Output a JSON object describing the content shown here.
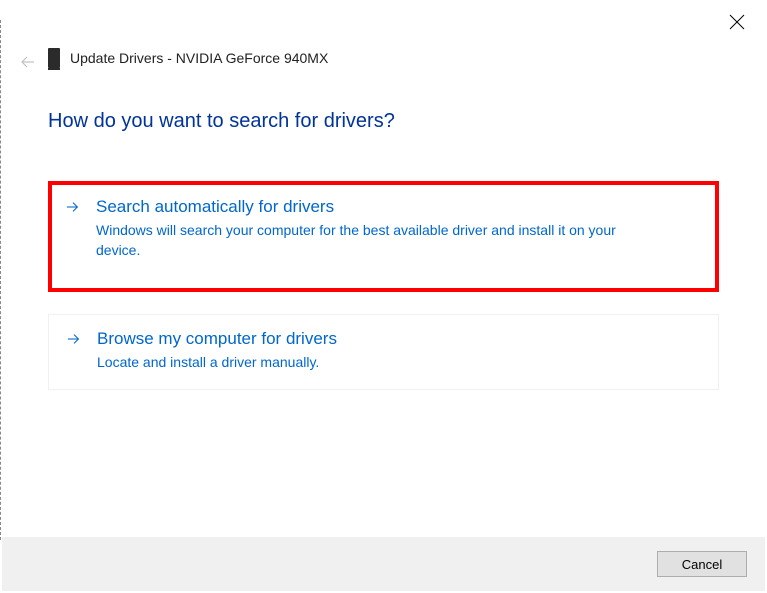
{
  "header": {
    "title": "Update Drivers - NVIDIA GeForce 940MX"
  },
  "heading": "How do you want to search for drivers?",
  "options": [
    {
      "title": "Search automatically for drivers",
      "desc": "Windows will search your computer for the best available driver and install it on your device."
    },
    {
      "title": "Browse my computer for drivers",
      "desc": "Locate and install a driver manually."
    }
  ],
  "footer": {
    "cancel": "Cancel"
  }
}
